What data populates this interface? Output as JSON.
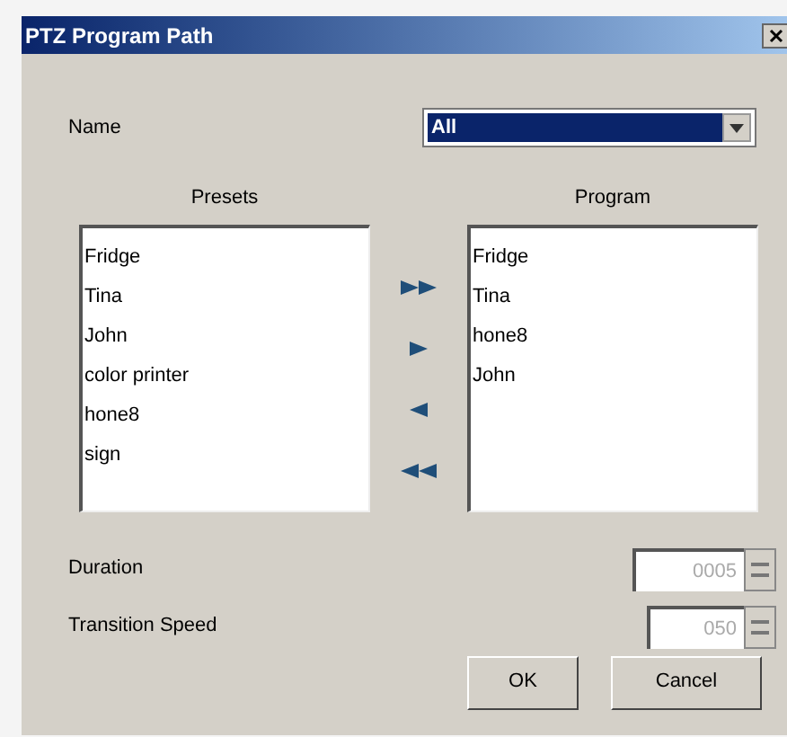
{
  "window": {
    "title": "PTZ Program Path"
  },
  "name_field": {
    "label": "Name",
    "value": "All"
  },
  "presets": {
    "heading": "Presets",
    "items": [
      "Fridge",
      "Tina",
      "John",
      "color printer",
      "hone8",
      "sign"
    ]
  },
  "program": {
    "heading": "Program",
    "items": [
      "Fridge",
      "Tina",
      "hone8",
      "John"
    ]
  },
  "transfer_buttons": [
    {
      "kind": "add_all"
    },
    {
      "kind": "add"
    },
    {
      "kind": "remove"
    },
    {
      "kind": "remove_all"
    }
  ],
  "settings": [
    {
      "label": "Duration",
      "value": "0005",
      "disabled": true
    },
    {
      "label": "Transition Speed",
      "value": "050",
      "disabled": true
    }
  ],
  "buttons": [
    "OK",
    "Cancel"
  ]
}
